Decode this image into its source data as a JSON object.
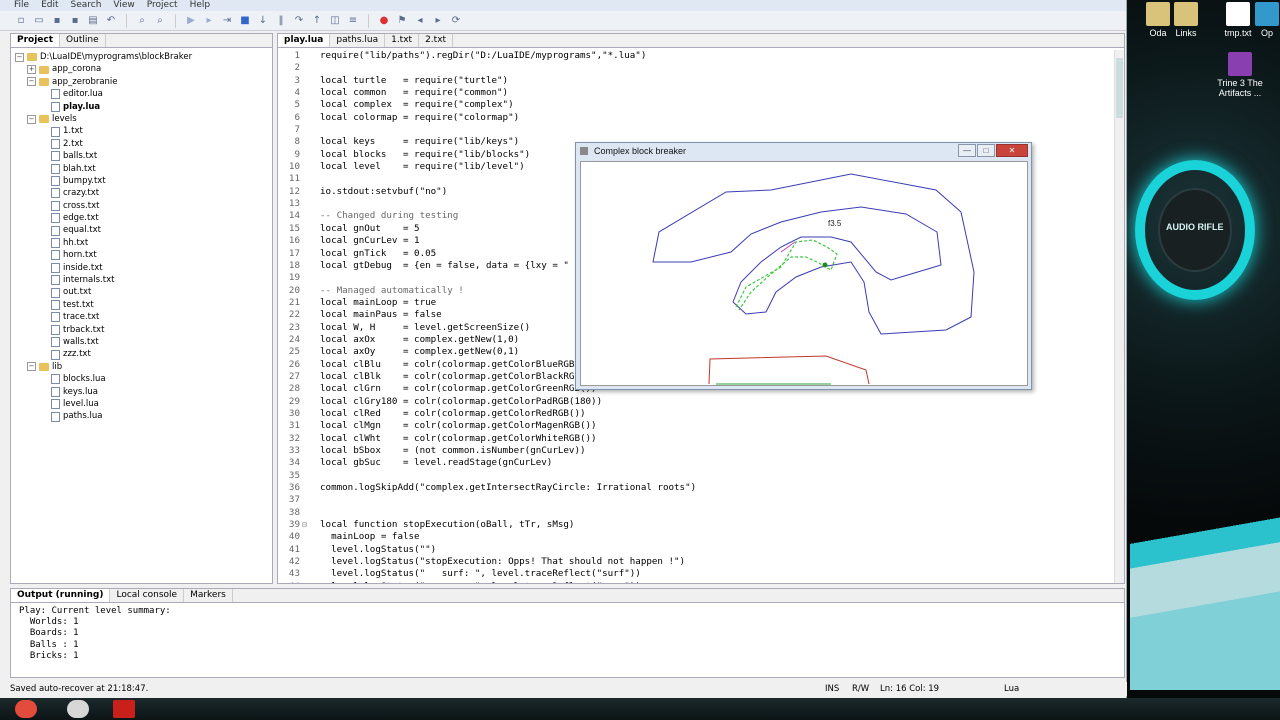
{
  "menu": [
    "File",
    "Edit",
    "Search",
    "View",
    "Project",
    "Help"
  ],
  "project_panel": {
    "tabs": [
      "Project",
      "Outline"
    ],
    "tree": [
      {
        "label": "D:\\LuaIDE\\myprograms\\blockBraker",
        "depth": 0,
        "type": "root",
        "exp": "−"
      },
      {
        "label": "app_corona",
        "depth": 1,
        "type": "folder",
        "exp": "+"
      },
      {
        "label": "app_zerobranie",
        "depth": 1,
        "type": "folder",
        "exp": "−"
      },
      {
        "label": "editor.lua",
        "depth": 2,
        "type": "file"
      },
      {
        "label": "play.lua",
        "depth": 2,
        "type": "file",
        "bold": true
      },
      {
        "label": "levels",
        "depth": 1,
        "type": "folder",
        "exp": "−"
      },
      {
        "label": "1.txt",
        "depth": 2,
        "type": "file"
      },
      {
        "label": "2.txt",
        "depth": 2,
        "type": "file"
      },
      {
        "label": "balls.txt",
        "depth": 2,
        "type": "file"
      },
      {
        "label": "blah.txt",
        "depth": 2,
        "type": "file"
      },
      {
        "label": "bumpy.txt",
        "depth": 2,
        "type": "file"
      },
      {
        "label": "crazy.txt",
        "depth": 2,
        "type": "file"
      },
      {
        "label": "cross.txt",
        "depth": 2,
        "type": "file"
      },
      {
        "label": "edge.txt",
        "depth": 2,
        "type": "file"
      },
      {
        "label": "equal.txt",
        "depth": 2,
        "type": "file"
      },
      {
        "label": "hh.txt",
        "depth": 2,
        "type": "file"
      },
      {
        "label": "horn.txt",
        "depth": 2,
        "type": "file"
      },
      {
        "label": "inside.txt",
        "depth": 2,
        "type": "file"
      },
      {
        "label": "internals.txt",
        "depth": 2,
        "type": "file"
      },
      {
        "label": "out.txt",
        "depth": 2,
        "type": "file"
      },
      {
        "label": "test.txt",
        "depth": 2,
        "type": "file"
      },
      {
        "label": "trace.txt",
        "depth": 2,
        "type": "file"
      },
      {
        "label": "trback.txt",
        "depth": 2,
        "type": "file"
      },
      {
        "label": "walls.txt",
        "depth": 2,
        "type": "file"
      },
      {
        "label": "zzz.txt",
        "depth": 2,
        "type": "file"
      },
      {
        "label": "lib",
        "depth": 1,
        "type": "folder",
        "exp": "−"
      },
      {
        "label": "blocks.lua",
        "depth": 2,
        "type": "file"
      },
      {
        "label": "keys.lua",
        "depth": 2,
        "type": "file"
      },
      {
        "label": "level.lua",
        "depth": 2,
        "type": "file"
      },
      {
        "label": "paths.lua",
        "depth": 2,
        "type": "file"
      }
    ]
  },
  "editor": {
    "tabs": [
      "play.lua",
      "paths.lua",
      "1.txt",
      "2.txt"
    ],
    "lines": [
      "require(\"lib/paths\").regDir(\"D:/LuaIDE/myprograms\",\"*.lua\")",
      "",
      "local turtle   = require(\"turtle\")",
      "local common   = require(\"common\")",
      "local complex  = require(\"complex\")",
      "local colormap = require(\"colormap\")",
      "",
      "local keys     = require(\"lib/keys\")",
      "local blocks   = require(\"lib/blocks\")",
      "local level    = require(\"lib/level\")",
      "",
      "io.stdout:setvbuf(\"no\")",
      "",
      "-- Changed during testing",
      "local gnOut    = 5",
      "local gnCurLev = 1",
      "local gnTick   = 0.05",
      "local gtDebug  = {en = false, data = {lxy = \"",
      "",
      "-- Managed automatically !",
      "local mainLoop = true",
      "local mainPaus = false",
      "local W, H     = level.getScreenSize()",
      "local axOx     = complex.getNew(1,0)",
      "local axOy     = complex.getNew(0,1)",
      "local clBlu    = colr(colormap.getColorBlueRGB",
      "local clBlk    = colr(colormap.getColorBlackRG",
      "local clGrn    = colr(colormap.getColorGreenRGB())",
      "local clGry180 = colr(colormap.getColorPadRGB(180))",
      "local clRed    = colr(colormap.getColorRedRGB())",
      "local clMgn    = colr(colormap.getColorMagenRGB())",
      "local clWht    = colr(colormap.getColorWhiteRGB())",
      "local bSbox    = (not common.isNumber(gnCurLev))",
      "local gbSuc    = level.readStage(gnCurLev)",
      "",
      "common.logSkipAdd(\"complex.getIntersectRayCircle: Irrational roots\")",
      "",
      "",
      "local function stopExecution(oBall, tTr, sMsg)",
      "  mainLoop = false",
      "  level.logStatus(\"\")",
      "  level.logStatus(\"stopExecution: Opps! That should not happen !\")",
      "  level.logStatus(\"   surf: \", level.traceReflect(\"surf\"))",
      "  level.logStatus(\"   norm: \", level.traceReflect(\"norm\"))"
    ]
  },
  "output": {
    "tabs": [
      "Output (running)",
      "Local console",
      "Markers"
    ],
    "lines": [
      "Play: Current level summary:",
      "  Worlds: 1",
      "  Boards: 1",
      "  Balls : 1",
      "  Bricks: 1"
    ]
  },
  "status": {
    "message": "Saved auto-recover at 21:18:47.",
    "ins": "INS",
    "rw": "R/W",
    "pos": "Ln: 16 Col: 19",
    "lang": "Lua"
  },
  "game_window": {
    "title": "Complex block breaker",
    "label": "f3.5",
    "buttons": [
      "—",
      "□",
      "✕"
    ]
  },
  "desktop": {
    "icons": [
      "Oda",
      "Links",
      "tmp.txt",
      "Op",
      "Trine 3 The Artifacts ..."
    ],
    "speaker_text": "AUDIO RIFLE"
  },
  "colors": {
    "accent": "#19d3d8",
    "comment": "#6a6a6a",
    "string": "#a31515",
    "keyword": "#00007f"
  }
}
